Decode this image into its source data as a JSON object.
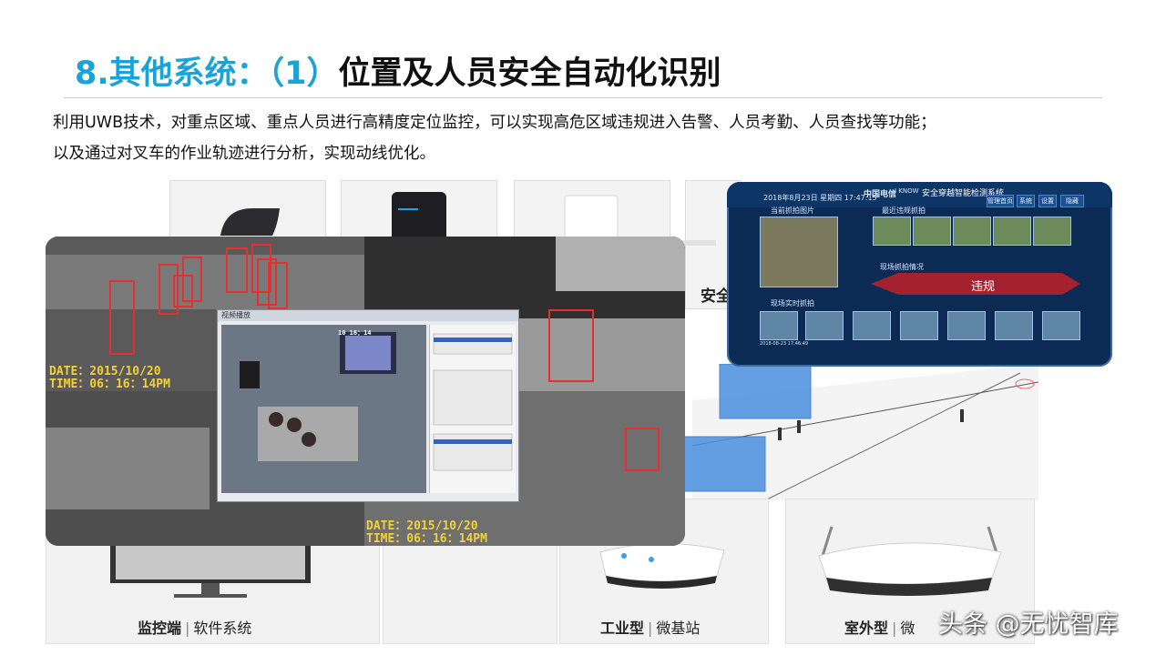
{
  "title": {
    "number": "8.其他系统：（1）",
    "main": "位置及人员安全自动化识别"
  },
  "description": [
    "利用UWB技术，对重点区域、重点人员进行高精度定位监控，可以实现高危区域违规进入告警、人员考勤、人员查找等功能；",
    "以及通过对叉车的作业轨迹进行分析，实现动线优化。"
  ],
  "cctv": {
    "osd_left": {
      "date": "DATE：2015/10/20",
      "time": "TIME：06：16：14PM"
    },
    "osd_bottom": {
      "date": "DATE：2015/10/20",
      "time": "TIME：06：16：14PM"
    }
  },
  "vms_window": {
    "title": "视频播放",
    "clock": "10 16：14"
  },
  "dashboard": {
    "system_title": "安全穿越智能检测系统",
    "brand": "中国电信",
    "brand2": "I KNOW",
    "datetime": "2018年8月23日 星期四 17:47:15",
    "buttons": [
      "管理首页",
      "系统",
      "设置",
      "隐藏"
    ],
    "panels": {
      "capture_image": "当前抓拍图片",
      "recent_capture": "最近违规抓拍",
      "scene_capture": "现场抓拍情况",
      "live_capture": "现场实时抓拍"
    },
    "violation_label": "违规",
    "thumb_caption": "2018-08-23 17:46:49"
  },
  "labels": {
    "safety_partial": "安全",
    "monitor": {
      "bold": "监控端",
      "rest": "软件系统"
    },
    "industrial": {
      "bold": "工业型",
      "rest": "微基站"
    },
    "outdoor": {
      "bold": "室外型",
      "rest": "微"
    }
  },
  "watermark": "头条 @无忧智库"
}
